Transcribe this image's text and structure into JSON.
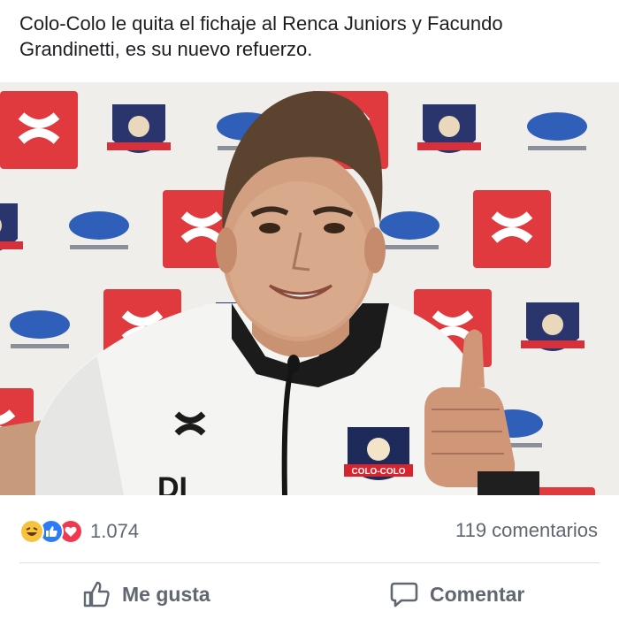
{
  "post": {
    "text": "Colo-Colo le quita el fichaje al Renca Juniors y Facundo Grandinetti, es su nuevo refuerzo."
  },
  "photo": {
    "backdrop_logos": [
      "under-armour-logo",
      "colo-colo-crest",
      "directv-logo"
    ],
    "jersey_crest_text": "COLO-COLO"
  },
  "stats": {
    "reactions": [
      "haha-icon",
      "like-icon",
      "love-icon"
    ],
    "reaction_count": "1.074",
    "comments": "119 comentarios"
  },
  "actions": {
    "like_label": "Me gusta",
    "comment_label": "Comentar"
  },
  "colors": {
    "text": "#1c1e21",
    "muted": "#606770",
    "like_blue": "#2d7cf6",
    "love_red": "#f0384f",
    "haha_yellow": "#f7c33c",
    "ua_red": "#e03a3e"
  }
}
